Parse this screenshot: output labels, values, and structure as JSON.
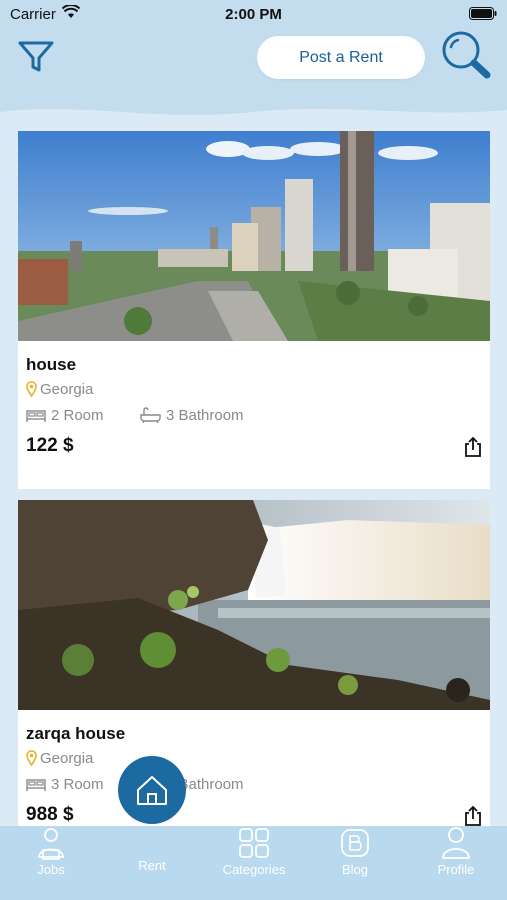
{
  "status_bar": {
    "carrier": "Carrier",
    "time": "2:00 PM"
  },
  "header": {
    "post_button_label": "Post a Rent"
  },
  "listings": [
    {
      "title": "house",
      "location": "Georgia",
      "rooms": "2 Room",
      "bathrooms": "3 Bathroom",
      "price": "122 $",
      "image": "city-skyline-photo"
    },
    {
      "title": "zarqa house",
      "location": "Georgia",
      "rooms": "3 Room",
      "bathrooms": "7 Bathroom",
      "price": "988 $",
      "image": "waterfall-photo"
    }
  ],
  "nav": {
    "jobs": "Jobs",
    "rent": "Rent",
    "categories": "Categories",
    "blog": "Blog",
    "profile": "Profile"
  },
  "colors": {
    "accent": "#1d6aa3",
    "header_bg": "#c3ddef",
    "nav_bg": "#b9d9ee",
    "page_bg": "#dbeaf5"
  }
}
